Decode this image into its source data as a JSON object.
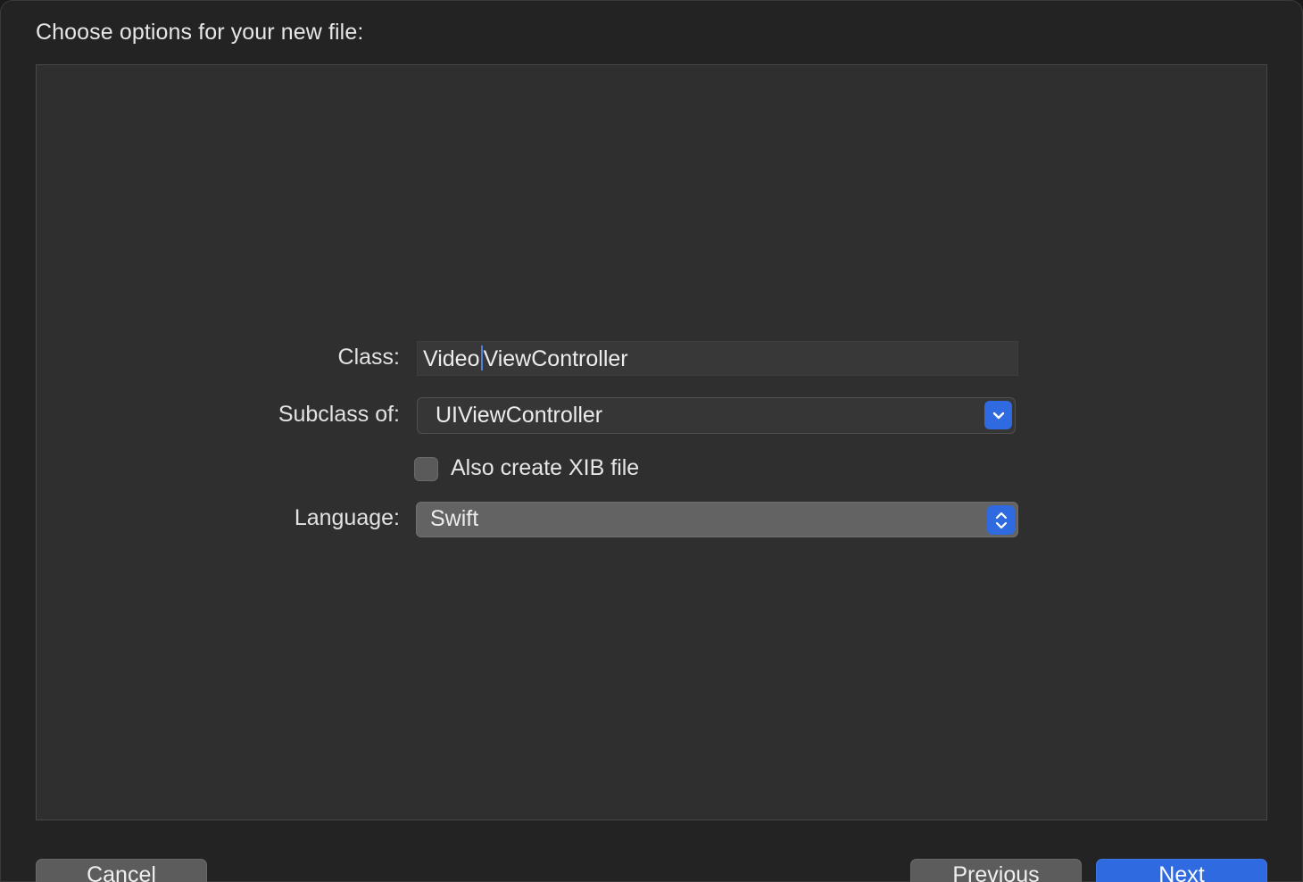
{
  "dialog": {
    "heading": "Choose options for your new file:"
  },
  "form": {
    "class_label": "Class:",
    "class_value_before_caret": "Video",
    "class_value_after_caret": "ViewController",
    "subclass_label": "Subclass of:",
    "subclass_value": "UIViewController",
    "xib_checkbox_label": "Also create XIB file",
    "xib_checked": false,
    "language_label": "Language:",
    "language_value": "Swift"
  },
  "footer": {
    "cancel_label": "Cancel",
    "previous_label": "Previous",
    "next_label": "Next"
  },
  "colors": {
    "accent": "#2f6ae0",
    "background": "#232323",
    "panel": "#2f2f2f"
  },
  "icons": {
    "subclass_arrow": "chevron-down-icon",
    "language_arrow": "up-down-chevron-icon"
  }
}
